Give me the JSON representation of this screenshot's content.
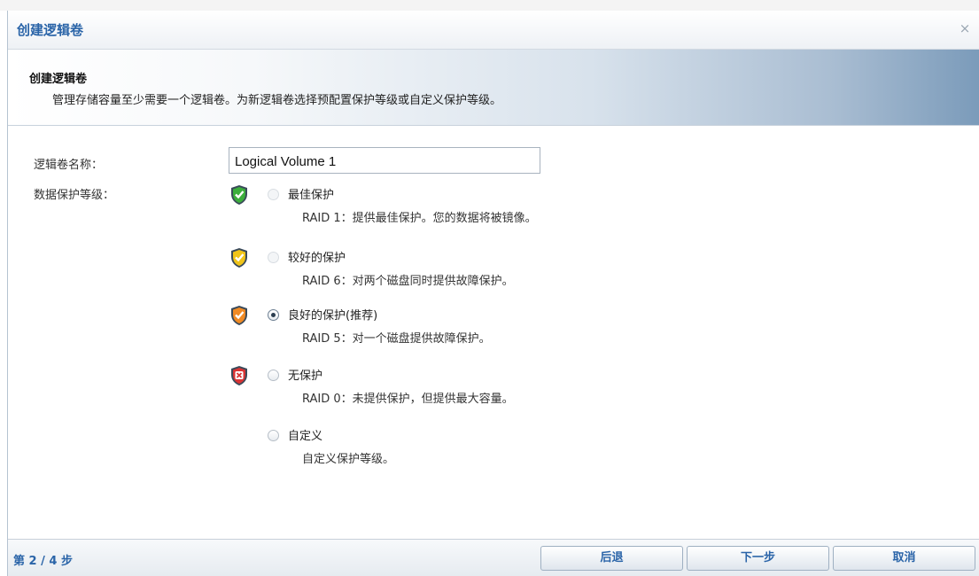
{
  "dialog": {
    "title": "创建逻辑卷",
    "close_glyph": "×"
  },
  "header": {
    "title": "创建逻辑卷",
    "description": "管理存储容量至少需要一个逻辑卷。为新逻辑卷选择预配置保护等级或自定义保护等级。"
  },
  "form": {
    "name_label": "逻辑卷名称：",
    "name_value": "Logical Volume 1",
    "protection_label": "数据保护等级："
  },
  "options": [
    {
      "label": "最佳保护",
      "desc": "RAID 1：提供最佳保护。您的数据将被镜像。",
      "icon": "green-shield-check-icon",
      "color": "#3cae3c",
      "selected": false
    },
    {
      "label": "较好的保护",
      "desc": "RAID 6：对两个磁盘同时提供故障保护。",
      "icon": "yellow-shield-check-icon",
      "color": "#f0c419",
      "selected": false
    },
    {
      "label": "良好的保护(推荐)",
      "desc": "RAID 5：对一个磁盘提供故障保护。",
      "icon": "orange-shield-check-icon",
      "color": "#f08a24",
      "selected": true
    },
    {
      "label": "无保护",
      "desc": "RAID 0：未提供保护，但提供最大容量。",
      "icon": "red-shield-x-icon",
      "color": "#d93434",
      "selected": false
    },
    {
      "label": "自定义",
      "desc": "自定义保护等级。",
      "icon": "",
      "color": "",
      "selected": false
    }
  ],
  "footer": {
    "step": "第 2 / 4 步",
    "back_label": "后退",
    "next_label": "下一步",
    "cancel_label": "取消"
  }
}
